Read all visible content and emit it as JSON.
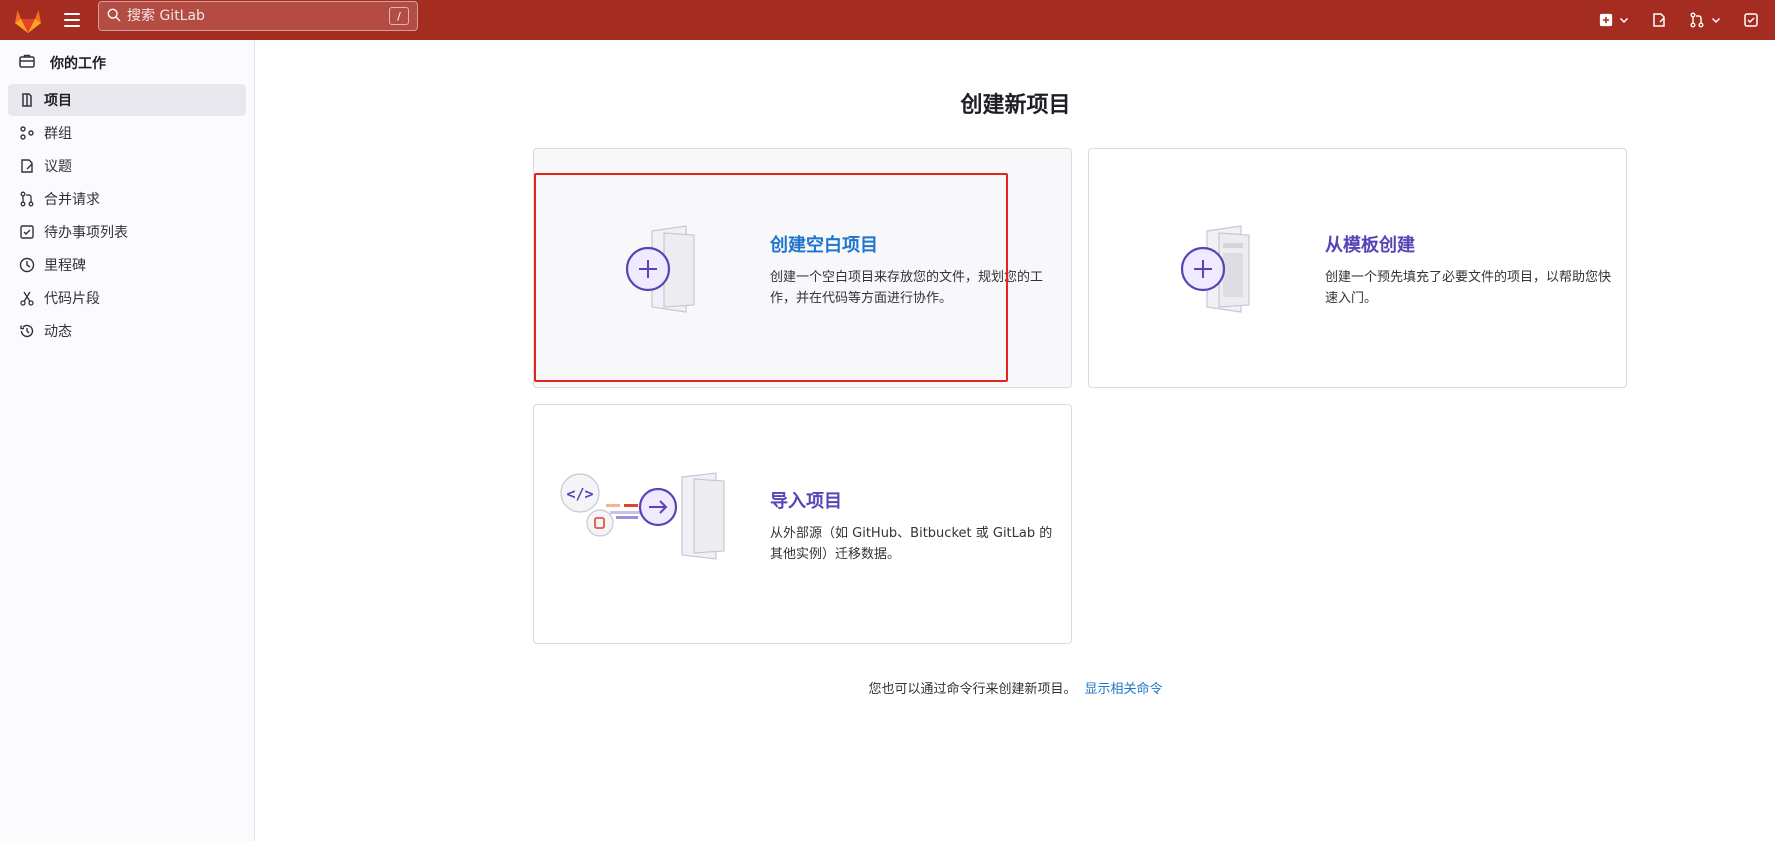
{
  "search": {
    "placeholder": "搜索 GitLab",
    "shortcut": "/"
  },
  "sidebar": {
    "header": "你的工作",
    "items": [
      {
        "label": "项目",
        "icon": "project-icon",
        "active": true
      },
      {
        "label": "群组",
        "icon": "group-icon"
      },
      {
        "label": "议题",
        "icon": "issues-icon"
      },
      {
        "label": "合并请求",
        "icon": "merge-request-icon"
      },
      {
        "label": "待办事项列表",
        "icon": "todo-icon"
      },
      {
        "label": "里程碑",
        "icon": "milestone-icon"
      },
      {
        "label": "代码片段",
        "icon": "snippet-icon"
      },
      {
        "label": "动态",
        "icon": "activity-icon"
      }
    ]
  },
  "main": {
    "title": "创建新项目",
    "cards": {
      "blank": {
        "title": "创建空白项目",
        "desc": "创建一个空白项目来存放您的文件，规划您的工作，并在代码等方面进行协作。"
      },
      "template": {
        "title": "从模板创建",
        "desc": "创建一个预先填充了必要文件的项目，以帮助您快速入门。"
      },
      "import": {
        "title": "导入项目",
        "desc": "从外部源（如 GitHub、Bitbucket 或 GitLab 的其他实例）迁移数据。"
      }
    },
    "footer": {
      "text": "您也可以通过命令行来创建新项目。",
      "link": "显示相关命令"
    }
  },
  "colors": {
    "topbar": "#a52c21",
    "link": "#1f75cb",
    "accent_purple": "#5943b6",
    "highlight": "#e0241e"
  }
}
